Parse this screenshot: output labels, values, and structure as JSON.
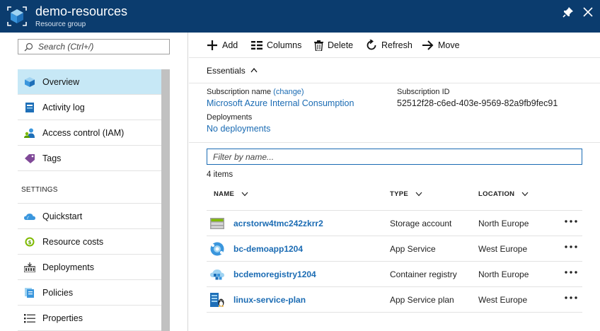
{
  "header": {
    "title": "demo-resources",
    "subtitle": "Resource group"
  },
  "search": {
    "placeholder": "Search (Ctrl+/)"
  },
  "menu": {
    "items": [
      {
        "label": "Overview",
        "icon": "overview-icon"
      },
      {
        "label": "Activity log",
        "icon": "activity-log-icon"
      },
      {
        "label": "Access control (IAM)",
        "icon": "access-control-icon"
      },
      {
        "label": "Tags",
        "icon": "tag-icon"
      }
    ],
    "section_settings": "SETTINGS",
    "settings_items": [
      {
        "label": "Quickstart",
        "icon": "quickstart-cloud-icon"
      },
      {
        "label": "Resource costs",
        "icon": "resource-costs-icon"
      },
      {
        "label": "Deployments",
        "icon": "deployments-icon"
      },
      {
        "label": "Policies",
        "icon": "policies-icon"
      },
      {
        "label": "Properties",
        "icon": "properties-icon"
      }
    ]
  },
  "toolbar": {
    "add": "Add",
    "columns": "Columns",
    "delete": "Delete",
    "refresh": "Refresh",
    "move": "Move"
  },
  "essentials": {
    "label": "Essentials",
    "subscription_name_label": "Subscription name",
    "change_link": "(change)",
    "subscription_name": "Microsoft Azure Internal Consumption",
    "subscription_id_label": "Subscription ID",
    "subscription_id": "52512f28-c6ed-403e-9569-82a9fb9fec91",
    "deployments_label": "Deployments",
    "deployments_value": "No deployments"
  },
  "filter": {
    "placeholder": "Filter by name..."
  },
  "items_count": "4 items",
  "columns": {
    "name": "NAME",
    "type": "TYPE",
    "location": "LOCATION"
  },
  "resources": [
    {
      "name": "acrstorw4tmc242zkrr2",
      "type": "Storage account",
      "location": "North Europe",
      "icon": "storage-account-icon"
    },
    {
      "name": "bc-demoapp1204",
      "type": "App Service",
      "location": "West Europe",
      "icon": "app-service-icon"
    },
    {
      "name": "bcdemoregistry1204",
      "type": "Container registry",
      "location": "North Europe",
      "icon": "container-registry-icon"
    },
    {
      "name": "linux-service-plan",
      "type": "App Service plan",
      "location": "West Europe",
      "icon": "app-service-plan-icon"
    }
  ],
  "colors": {
    "header_bg": "#0b3c6e",
    "selected_bg": "#c7e8f6",
    "link": "#1a6bb3"
  }
}
